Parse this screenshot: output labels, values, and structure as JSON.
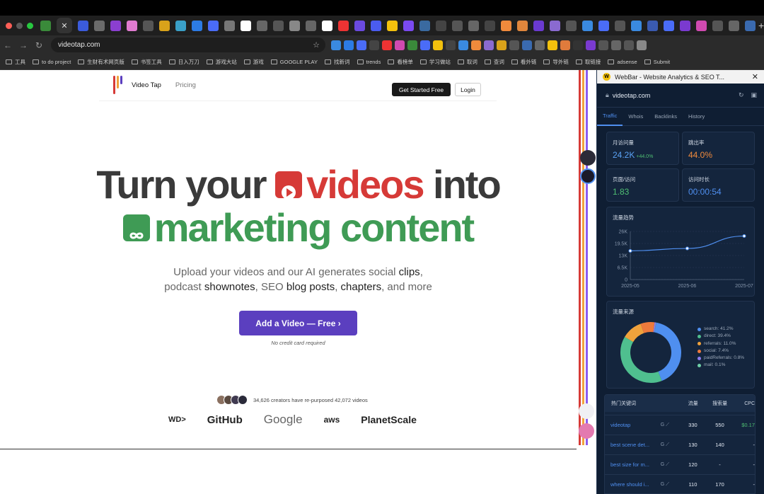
{
  "browser": {
    "url": "videotap.com",
    "bookmarks": [
      "工具",
      "to do project",
      "生财有术网页版",
      "书签工具",
      "日入万刀",
      "游戏大站",
      "游戏",
      "GOOGLE PLAY",
      "找新词",
      "trends",
      "看榜单",
      "学习做站",
      "取词",
      "查词",
      "看外链",
      "导外链",
      "取链接",
      "adsense",
      "Submit"
    ],
    "colors": {
      "tab_bg": "#1f1f1f",
      "toolbar_bg": "#2b2b2b"
    }
  },
  "site": {
    "brand": "Video Tap",
    "nav_pricing": "Pricing",
    "get_started": "Get Started Free",
    "login": "Login",
    "headline_part1": "Turn your",
    "headline_part2": "videos",
    "headline_part3": "into",
    "headline_part4": "marketing content",
    "sub_line1_a": "Upload your videos and our AI generates social ",
    "sub_line1_b": "clips",
    "sub_line1_c": ",",
    "sub_line2_a": "podcast ",
    "sub_line2_b": "shownotes",
    "sub_line2_c": ", SEO ",
    "sub_line2_d": "blog posts",
    "sub_line2_e": ", ",
    "sub_line2_f": "chapters",
    "sub_line2_g": ", and more",
    "cta": "Add a Video — Free ›",
    "no_credit": "No credit card required",
    "creators": "34,626 creators have re-purposed 42,072 videos",
    "logos": [
      "GitHub",
      "Google",
      "aws",
      "PlanetScale"
    ],
    "logo_wd": "WD>",
    "colors": {
      "red": "#d63a37",
      "green": "#3f9b55",
      "purple": "#5b3fbf"
    }
  },
  "webbar": {
    "title": "WebBar - Website Analytics & SEO T...",
    "domain": "videotap.com",
    "tabs": [
      "Traffic",
      "Whois",
      "Backlinks",
      "History"
    ],
    "stats": [
      {
        "label": "月访问量",
        "value": "24.2K",
        "delta": "+44.0%",
        "color": "#5aa2f5"
      },
      {
        "label": "跳出率",
        "value": "44.0%",
        "color": "#f08a3c"
      },
      {
        "label": "页面/访问",
        "value": "1.83",
        "color": "#4fbf73"
      },
      {
        "label": "访问时长",
        "value": "00:00:54",
        "color": "#4f8ff0"
      }
    ],
    "trend_title": "流量趋势",
    "sources_title": "流量来源",
    "sources": [
      {
        "label": "search: 41.2%",
        "color": "#4f8ff0"
      },
      {
        "label": "direct: 39.4%",
        "color": "#4fbf8f"
      },
      {
        "label": "referrals: 11.0%",
        "color": "#f0a23c"
      },
      {
        "label": "social: 7.4%",
        "color": "#ee7a3c"
      },
      {
        "label": "paidReferrals: 0.8%",
        "color": "#8b7cf0"
      },
      {
        "label": "mail: 0.1%",
        "color": "#6fd0a8"
      }
    ],
    "kw_title": "热门关键词",
    "kw_cols": [
      "流量",
      "搜索量",
      "CPC"
    ],
    "keywords": [
      {
        "k": "videotap",
        "traffic": "330",
        "volume": "550",
        "cpc": "$0.17"
      },
      {
        "k": "best scene det...",
        "traffic": "130",
        "volume": "140",
        "cpc": "-"
      },
      {
        "k": "best size for m...",
        "traffic": "120",
        "volume": "-",
        "cpc": "-"
      },
      {
        "k": "where should i...",
        "traffic": "110",
        "volume": "170",
        "cpc": "-"
      }
    ]
  },
  "chart_data": [
    {
      "type": "line",
      "title": "流量趋势",
      "x": [
        "2025-05",
        "2025-06",
        "2025-07"
      ],
      "series": [
        {
          "values": [
            15500,
            16800,
            23500
          ]
        }
      ],
      "ylim": [
        0,
        26000
      ],
      "yticks": [
        "26K",
        "19.5K",
        "13K",
        "6.5K",
        "0"
      ]
    },
    {
      "type": "pie",
      "title": "流量来源",
      "categories": [
        "search",
        "direct",
        "referrals",
        "social",
        "paidReferrals",
        "mail"
      ],
      "values": [
        41.2,
        39.4,
        11.0,
        7.4,
        0.8,
        0.1
      ]
    }
  ]
}
